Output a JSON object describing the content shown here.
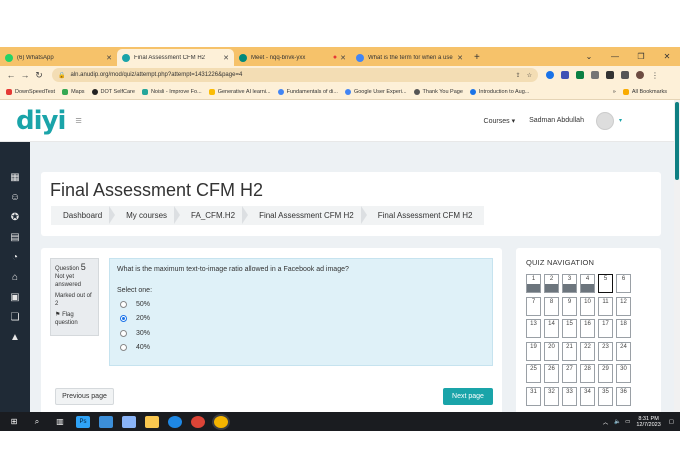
{
  "browser": {
    "tabs": [
      {
        "label": "(6) WhatsApp",
        "color": "#25d366"
      },
      {
        "label": "Final Assessment CFM H2",
        "color": "#1aa4a9",
        "active": true
      },
      {
        "label": "Meet - nqq-bnvk-yxx",
        "color": "#00897b"
      },
      {
        "label": "What is the term for when a use",
        "color": "#4285f4"
      }
    ],
    "url": "aln.anudip.org/mod/quiz/attempt.php?attempt=1431226&page=4",
    "bookmarks": [
      {
        "label": "DownSpeedTest",
        "color": "#e53935"
      },
      {
        "label": "Maps",
        "color": "#34a853"
      },
      {
        "label": "DOT SelfCare",
        "color": "#222222"
      },
      {
        "label": "Noisli - Improve Fo...",
        "color": "#26a69a"
      },
      {
        "label": "Generative AI learni...",
        "color": "#fbbc05"
      },
      {
        "label": "Fundamentals of di...",
        "color": "#4285f4"
      },
      {
        "label": "Google User Experi...",
        "color": "#4285f4"
      },
      {
        "label": "Thank You Page",
        "color": "#555555"
      },
      {
        "label": "Introduction to Aug...",
        "color": "#1a73e8"
      }
    ],
    "all_bookmarks": "All Bookmarks",
    "more_bookmarks": "»"
  },
  "header": {
    "logo": "diyi",
    "courses": "Courses",
    "user": "Sadman Abdullah"
  },
  "page": {
    "title": "Final Assessment CFM H2",
    "breadcrumbs": [
      "Dashboard",
      "My courses",
      "FA_CFM.H2",
      "Final Assessment CFM H2",
      "Final Assessment CFM H2"
    ]
  },
  "question": {
    "label": "Question",
    "number": "5",
    "status_line1": "Not yet",
    "status_line2": "answered",
    "marks_line1": "Marked out of",
    "marks_line2": "2",
    "flag_line1": "Flag",
    "flag_line2": "question",
    "text": "What is the maximum text-to-image ratio allowed in a Facebook ad image?",
    "select_one": "Select one:",
    "options": [
      "50%",
      "20%",
      "30%",
      "40%"
    ],
    "selected_index": 1
  },
  "buttons": {
    "previous": "Previous page",
    "next": "Next page"
  },
  "quiz_nav": {
    "title": "QUIZ NAVIGATION",
    "numbers": [
      "1",
      "2",
      "3",
      "4",
      "5",
      "6",
      "7",
      "8",
      "9",
      "10",
      "11",
      "12",
      "13",
      "14",
      "15",
      "16",
      "17",
      "18",
      "19",
      "20",
      "21",
      "22",
      "23",
      "24",
      "25",
      "26",
      "27",
      "28",
      "29",
      "30",
      "31",
      "32",
      "33",
      "34",
      "35",
      "36"
    ],
    "answered": [
      "1",
      "2",
      "3",
      "4"
    ],
    "current": "5"
  },
  "taskbar": {
    "time": "8:31 PM",
    "date": "12/7/2023"
  }
}
